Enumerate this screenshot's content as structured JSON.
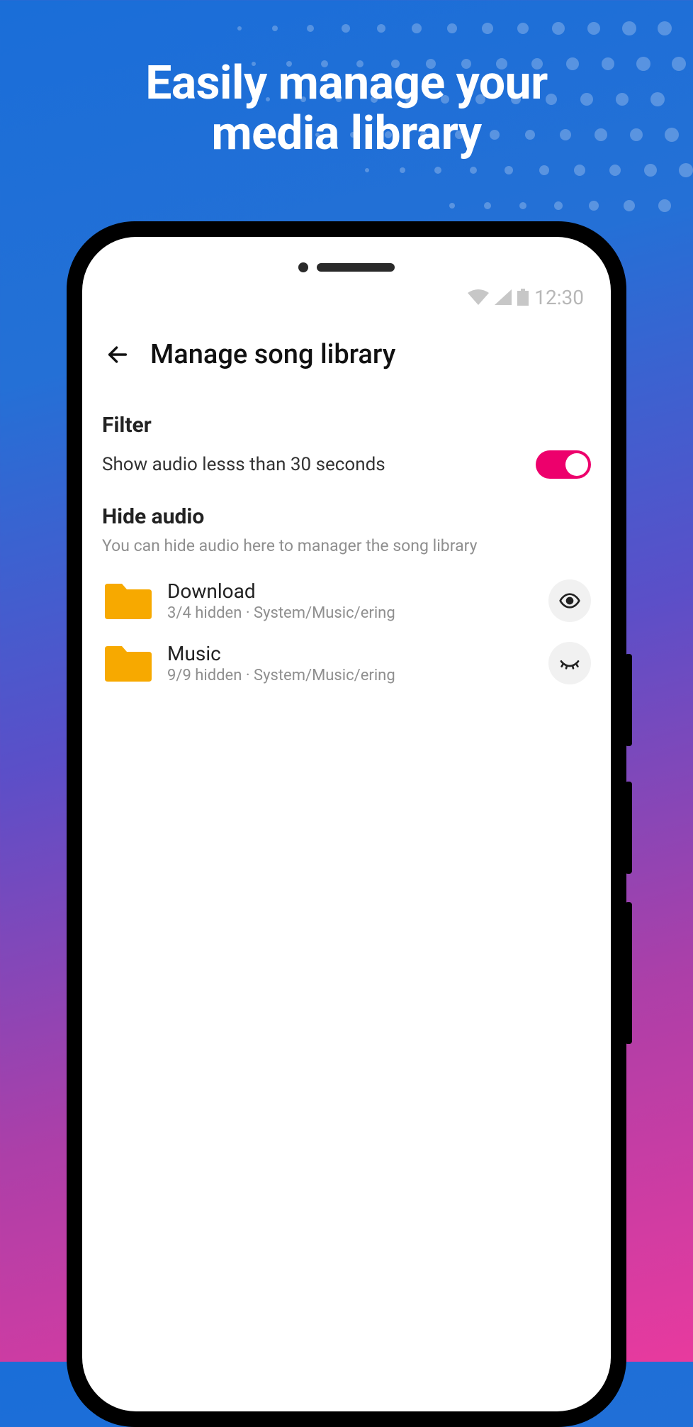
{
  "promo": {
    "title_line1": "Easily manage your",
    "title_line2": "media library"
  },
  "status": {
    "time": "12:30"
  },
  "header": {
    "title": "Manage song library"
  },
  "filter": {
    "section_title": "Filter",
    "label": "Show audio lesss than 30 seconds",
    "enabled": true
  },
  "hide_audio": {
    "section_title": "Hide audio",
    "subtitle": "You can hide audio here to manager the song library",
    "folders": [
      {
        "name": "Download",
        "meta": "3/4 hidden · System/Music/ering",
        "state": "visible"
      },
      {
        "name": "Music",
        "meta": "9/9 hidden · System/Music/ering",
        "state": "hidden"
      }
    ]
  }
}
